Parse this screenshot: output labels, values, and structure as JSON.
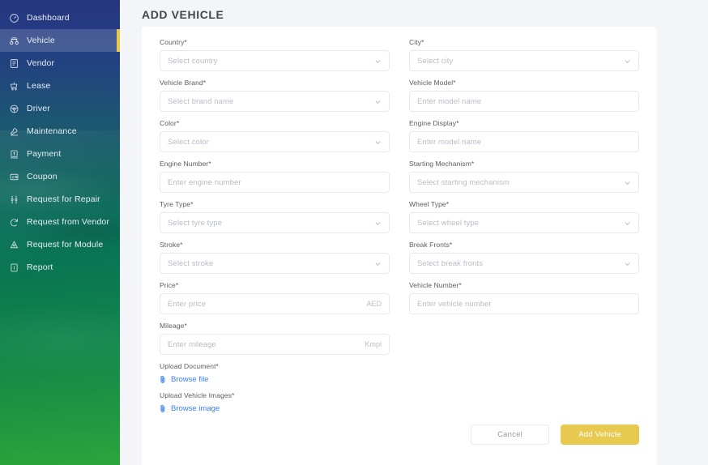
{
  "sidebar": {
    "items": [
      {
        "label": "Dashboard",
        "icon": "gauge-icon",
        "active": false
      },
      {
        "label": "Vehicle",
        "icon": "vehicle-icon",
        "active": true
      },
      {
        "label": "Vendor",
        "icon": "vendor-icon",
        "active": false
      },
      {
        "label": "Lease",
        "icon": "lease-icon",
        "active": false
      },
      {
        "label": "Driver",
        "icon": "steering-wheel-icon",
        "active": false
      },
      {
        "label": "Maintenance",
        "icon": "maintenance-icon",
        "active": false
      },
      {
        "label": "Payment",
        "icon": "payment-icon",
        "active": false
      },
      {
        "label": "Coupon",
        "icon": "coupon-icon",
        "active": false
      },
      {
        "label": "Request for Repair",
        "icon": "repair-icon",
        "active": false
      },
      {
        "label": "Request from Vendor",
        "icon": "refresh-icon",
        "active": false
      },
      {
        "label": "Request for Module",
        "icon": "module-icon",
        "active": false
      },
      {
        "label": "Report",
        "icon": "report-icon",
        "active": false
      }
    ],
    "accent_color": "#e8c84a",
    "active_background": "rgba(255,255,255,0.16)"
  },
  "page": {
    "title": "ADD VEHICLE"
  },
  "form": {
    "required_marker": "*",
    "fields": {
      "country": {
        "label": "Country",
        "placeholder": "Select country",
        "type": "select"
      },
      "city": {
        "label": "City",
        "placeholder": "Select city",
        "type": "select"
      },
      "vehicle_brand": {
        "label": "Vehicle Brand",
        "placeholder": "Select brand name",
        "type": "select"
      },
      "vehicle_model": {
        "label": "Vehicle Model",
        "placeholder": "Enter model name",
        "type": "text"
      },
      "color": {
        "label": "Color",
        "placeholder": "Select color",
        "type": "select"
      },
      "engine_display": {
        "label": "Engine Display",
        "placeholder": "Enter model name",
        "type": "text"
      },
      "engine_number": {
        "label": "Engine Number",
        "placeholder": "Enter engine number",
        "type": "text"
      },
      "starting_mechanism": {
        "label": "Starting Mechanism",
        "placeholder": "Select starting mechanism",
        "type": "select"
      },
      "tyre_type": {
        "label": "Tyre Type",
        "placeholder": "Select tyre type",
        "type": "select"
      },
      "wheel_type": {
        "label": "Wheel Type",
        "placeholder": "Select wheel type",
        "type": "select"
      },
      "stroke": {
        "label": "Stroke",
        "placeholder": "Select stroke",
        "type": "select"
      },
      "break_fronts": {
        "label": "Break Fronts",
        "placeholder": "Select break fronts",
        "type": "select"
      },
      "price": {
        "label": "Price",
        "placeholder": "Enter price",
        "suffix": "AED",
        "type": "text"
      },
      "vehicle_number": {
        "label": "Vehicle Number",
        "placeholder": "Enter vehicle number",
        "type": "text"
      },
      "mileage": {
        "label": "Mileage",
        "placeholder": "Enter mileage",
        "suffix": "Kmpl",
        "type": "text"
      }
    },
    "uploads": {
      "document": {
        "label": "Upload Document",
        "link": "Browse file"
      },
      "vehicle_images": {
        "label": "Upload Vehicle Images",
        "link": "Browse image"
      }
    },
    "actions": {
      "cancel": "Cancel",
      "submit": "Add Vehicle",
      "submit_color": "#e8ca51"
    }
  }
}
